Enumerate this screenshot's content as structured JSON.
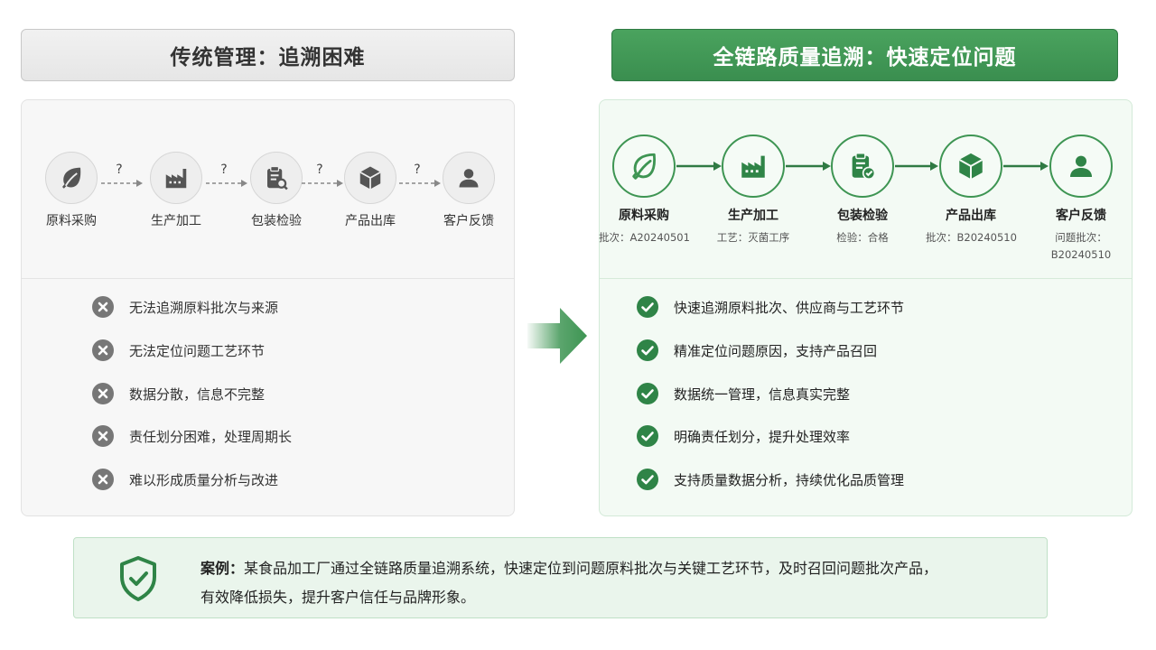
{
  "left": {
    "title": "传统管理：追溯困难",
    "flow": [
      {
        "label": "原料采购",
        "icon": "leaf-icon"
      },
      {
        "label": "生产加工",
        "icon": "factory-icon"
      },
      {
        "label": "包装检验",
        "icon": "clipboard-search-icon"
      },
      {
        "label": "产品出库",
        "icon": "box-icon"
      },
      {
        "label": "客户反馈",
        "icon": "user-icon"
      }
    ],
    "connector_mark": "?",
    "problems": [
      "无法追溯原料批次与来源",
      "无法定位问题工艺环节",
      "数据分散，信息不完整",
      "责任划分困难，处理周期长",
      "难以形成质量分析与改进"
    ]
  },
  "right": {
    "title": "全链路质量追溯：快速定位问题",
    "flow": [
      {
        "label": "原料采购",
        "sub": [
          "批次：A20240501"
        ],
        "icon": "leaf-icon"
      },
      {
        "label": "生产加工",
        "sub": [
          "工艺：灭菌工序"
        ],
        "icon": "factory-icon"
      },
      {
        "label": "包装检验",
        "sub": [
          "检验：合格"
        ],
        "icon": "clipboard-check-icon"
      },
      {
        "label": "产品出库",
        "sub": [
          "批次：B20240510"
        ],
        "icon": "box-icon"
      },
      {
        "label": "客户反馈",
        "sub": [
          "问题批次：",
          "B20240510"
        ],
        "icon": "user-icon"
      }
    ],
    "benefits": [
      "快速追溯原料批次、供应商与工艺环节",
      "精准定位问题原因，支持产品召回",
      "数据统一管理，信息真实完整",
      "明确责任划分，提升处理效率",
      "支持质量数据分析，持续优化品质管理"
    ]
  },
  "case": {
    "prefix": "案例：",
    "line1": "某食品加工厂通过全链路质量追溯系统，快速定位到问题原料批次与关键工艺环节，及时召回问题批次产品，",
    "line2": "有效降低损失，提升客户信任与品牌形象。"
  },
  "colors": {
    "green": "#3e9553",
    "green_dark": "#2f7a43",
    "grey_icon": "#555555",
    "grey_x": "#777777"
  }
}
